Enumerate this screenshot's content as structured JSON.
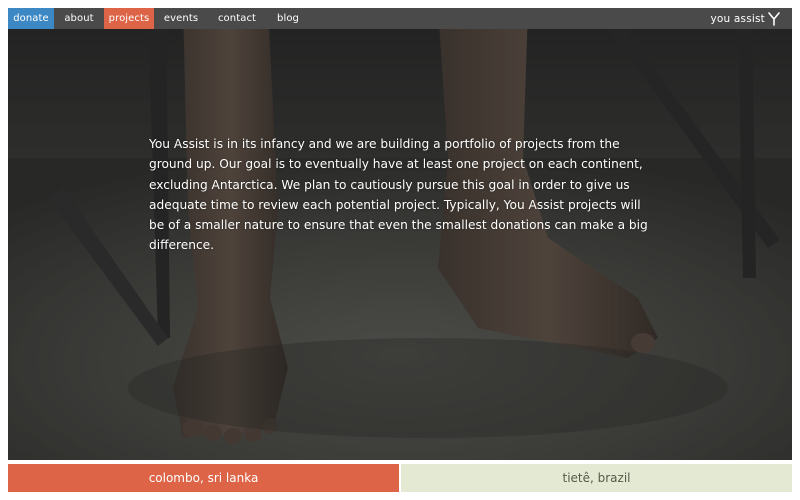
{
  "nav": {
    "items": [
      {
        "label": "donate",
        "key": "donate",
        "state": "highlight-blue"
      },
      {
        "label": "about",
        "key": "about",
        "state": "normal"
      },
      {
        "label": "projects",
        "key": "projects",
        "state": "active"
      },
      {
        "label": "events",
        "key": "events",
        "state": "normal"
      },
      {
        "label": "contact",
        "key": "contact",
        "state": "normal"
      },
      {
        "label": "blog",
        "key": "blog",
        "state": "normal"
      }
    ],
    "brand": "you assist",
    "brand_icon": "you-assist-logo-icon"
  },
  "hero": {
    "text": "You Assist is in its infancy and we are building a portfolio of projects from the ground up. Our goal is to eventually have at least one project on each continent, excluding Antarctica. We plan to cautiously pursue this goal in order to give us adequate time to review each potential project. Typically, You Assist projects will be of a smaller nature to ensure that even the smallest donations can make a big difference."
  },
  "projects": [
    {
      "label": "colombo, sri lanka"
    },
    {
      "label": "tietê, brazil"
    }
  ],
  "colors": {
    "nav_bg": "#4a4a4a",
    "donate": "#3c88c5",
    "active": "#dd6446",
    "tile_alt": "#e3e9d2"
  }
}
